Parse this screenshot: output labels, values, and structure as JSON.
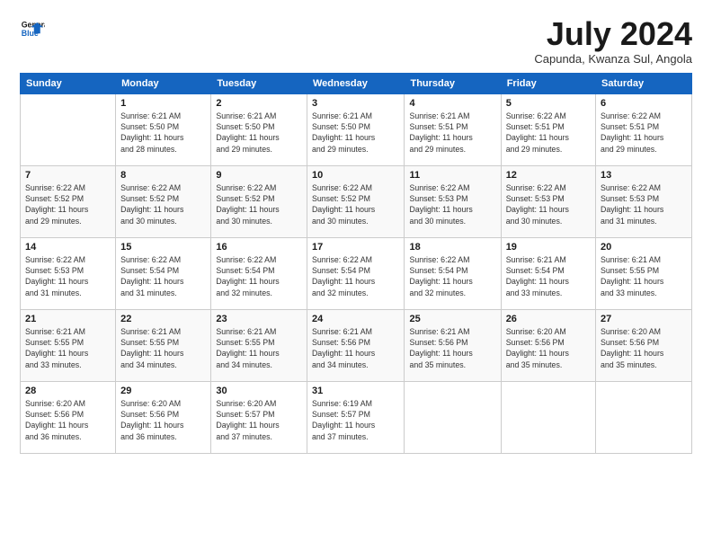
{
  "header": {
    "logo_line1": "General",
    "logo_line2": "Blue",
    "month": "July 2024",
    "location": "Capunda, Kwanza Sul, Angola"
  },
  "weekdays": [
    "Sunday",
    "Monday",
    "Tuesday",
    "Wednesday",
    "Thursday",
    "Friday",
    "Saturday"
  ],
  "weeks": [
    [
      {
        "num": "",
        "info": ""
      },
      {
        "num": "1",
        "info": "Sunrise: 6:21 AM\nSunset: 5:50 PM\nDaylight: 11 hours\nand 28 minutes."
      },
      {
        "num": "2",
        "info": "Sunrise: 6:21 AM\nSunset: 5:50 PM\nDaylight: 11 hours\nand 29 minutes."
      },
      {
        "num": "3",
        "info": "Sunrise: 6:21 AM\nSunset: 5:50 PM\nDaylight: 11 hours\nand 29 minutes."
      },
      {
        "num": "4",
        "info": "Sunrise: 6:21 AM\nSunset: 5:51 PM\nDaylight: 11 hours\nand 29 minutes."
      },
      {
        "num": "5",
        "info": "Sunrise: 6:22 AM\nSunset: 5:51 PM\nDaylight: 11 hours\nand 29 minutes."
      },
      {
        "num": "6",
        "info": "Sunrise: 6:22 AM\nSunset: 5:51 PM\nDaylight: 11 hours\nand 29 minutes."
      }
    ],
    [
      {
        "num": "7",
        "info": "Sunrise: 6:22 AM\nSunset: 5:52 PM\nDaylight: 11 hours\nand 29 minutes."
      },
      {
        "num": "8",
        "info": "Sunrise: 6:22 AM\nSunset: 5:52 PM\nDaylight: 11 hours\nand 30 minutes."
      },
      {
        "num": "9",
        "info": "Sunrise: 6:22 AM\nSunset: 5:52 PM\nDaylight: 11 hours\nand 30 minutes."
      },
      {
        "num": "10",
        "info": "Sunrise: 6:22 AM\nSunset: 5:52 PM\nDaylight: 11 hours\nand 30 minutes."
      },
      {
        "num": "11",
        "info": "Sunrise: 6:22 AM\nSunset: 5:53 PM\nDaylight: 11 hours\nand 30 minutes."
      },
      {
        "num": "12",
        "info": "Sunrise: 6:22 AM\nSunset: 5:53 PM\nDaylight: 11 hours\nand 30 minutes."
      },
      {
        "num": "13",
        "info": "Sunrise: 6:22 AM\nSunset: 5:53 PM\nDaylight: 11 hours\nand 31 minutes."
      }
    ],
    [
      {
        "num": "14",
        "info": "Sunrise: 6:22 AM\nSunset: 5:53 PM\nDaylight: 11 hours\nand 31 minutes."
      },
      {
        "num": "15",
        "info": "Sunrise: 6:22 AM\nSunset: 5:54 PM\nDaylight: 11 hours\nand 31 minutes."
      },
      {
        "num": "16",
        "info": "Sunrise: 6:22 AM\nSunset: 5:54 PM\nDaylight: 11 hours\nand 32 minutes."
      },
      {
        "num": "17",
        "info": "Sunrise: 6:22 AM\nSunset: 5:54 PM\nDaylight: 11 hours\nand 32 minutes."
      },
      {
        "num": "18",
        "info": "Sunrise: 6:22 AM\nSunset: 5:54 PM\nDaylight: 11 hours\nand 32 minutes."
      },
      {
        "num": "19",
        "info": "Sunrise: 6:21 AM\nSunset: 5:54 PM\nDaylight: 11 hours\nand 33 minutes."
      },
      {
        "num": "20",
        "info": "Sunrise: 6:21 AM\nSunset: 5:55 PM\nDaylight: 11 hours\nand 33 minutes."
      }
    ],
    [
      {
        "num": "21",
        "info": "Sunrise: 6:21 AM\nSunset: 5:55 PM\nDaylight: 11 hours\nand 33 minutes."
      },
      {
        "num": "22",
        "info": "Sunrise: 6:21 AM\nSunset: 5:55 PM\nDaylight: 11 hours\nand 34 minutes."
      },
      {
        "num": "23",
        "info": "Sunrise: 6:21 AM\nSunset: 5:55 PM\nDaylight: 11 hours\nand 34 minutes."
      },
      {
        "num": "24",
        "info": "Sunrise: 6:21 AM\nSunset: 5:56 PM\nDaylight: 11 hours\nand 34 minutes."
      },
      {
        "num": "25",
        "info": "Sunrise: 6:21 AM\nSunset: 5:56 PM\nDaylight: 11 hours\nand 35 minutes."
      },
      {
        "num": "26",
        "info": "Sunrise: 6:20 AM\nSunset: 5:56 PM\nDaylight: 11 hours\nand 35 minutes."
      },
      {
        "num": "27",
        "info": "Sunrise: 6:20 AM\nSunset: 5:56 PM\nDaylight: 11 hours\nand 35 minutes."
      }
    ],
    [
      {
        "num": "28",
        "info": "Sunrise: 6:20 AM\nSunset: 5:56 PM\nDaylight: 11 hours\nand 36 minutes."
      },
      {
        "num": "29",
        "info": "Sunrise: 6:20 AM\nSunset: 5:56 PM\nDaylight: 11 hours\nand 36 minutes."
      },
      {
        "num": "30",
        "info": "Sunrise: 6:20 AM\nSunset: 5:57 PM\nDaylight: 11 hours\nand 37 minutes."
      },
      {
        "num": "31",
        "info": "Sunrise: 6:19 AM\nSunset: 5:57 PM\nDaylight: 11 hours\nand 37 minutes."
      },
      {
        "num": "",
        "info": ""
      },
      {
        "num": "",
        "info": ""
      },
      {
        "num": "",
        "info": ""
      }
    ]
  ]
}
